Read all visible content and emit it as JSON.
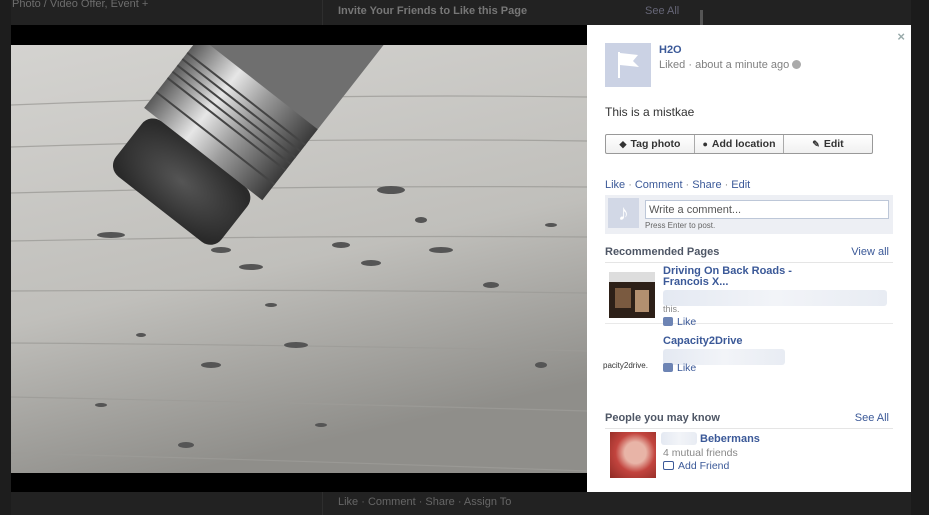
{
  "background": {
    "top_left_text": "Photo / Video   Offer, Event +",
    "invite_title": "Invite Your Friends to Like this Page",
    "see_all": "See All",
    "bottom_links": "Like · Comment · Share · Assign To"
  },
  "panel": {
    "close_label": "×",
    "owner_name": "H2O",
    "owner_meta": "Liked · about a minute ago",
    "caption": "This is a mistkae",
    "actions": {
      "tag_photo": "Tag photo",
      "add_location": "Add location",
      "edit": "Edit"
    },
    "links": {
      "like": "Like",
      "comment": "Comment",
      "share": "Share",
      "edit": "Edit"
    },
    "comment_box": {
      "placeholder": "Write a comment...",
      "hint": "Press Enter to post."
    },
    "recommended": {
      "title": "Recommended Pages",
      "view_all": "View all",
      "items": [
        {
          "name": "Driving On Back Roads - Francois X...",
          "small": "this.",
          "like": "Like",
          "thumb_text": ""
        },
        {
          "name": "Capacity2Drive",
          "small": "",
          "like": "Like",
          "thumb_text": "pacity2drive."
        }
      ]
    },
    "people": {
      "title": "People you may know",
      "see_all": "See All",
      "name": "Bebermans",
      "mutual": "4 mutual friends",
      "add_friend": "Add Friend"
    }
  },
  "colors": {
    "link": "#3b5998",
    "panel_bg": "#ffffff",
    "overlay": "#000000"
  }
}
